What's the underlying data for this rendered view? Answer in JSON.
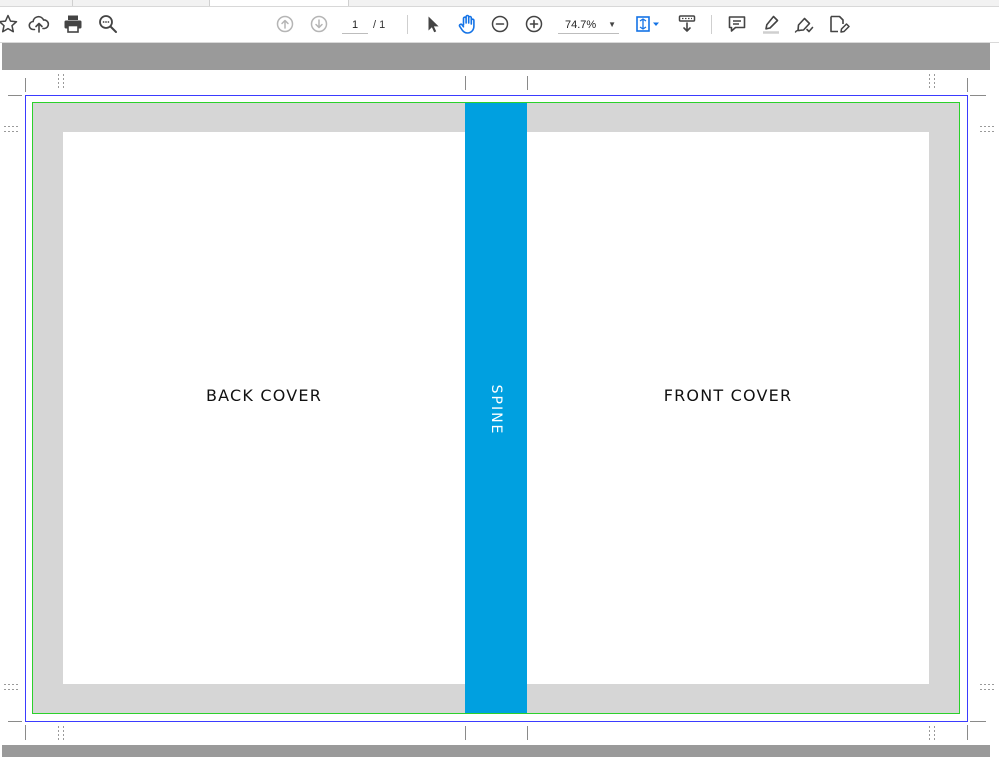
{
  "toolbar": {
    "icons": [
      "star-icon",
      "cloud-upload-icon",
      "print-icon",
      "search-icon",
      "page-up-icon",
      "page-down-icon",
      "select-arrow-icon",
      "hand-icon",
      "zoom-out-icon",
      "zoom-in-icon",
      "fit-page-icon",
      "page-display-icon",
      "comment-icon",
      "highlight-icon",
      "sign-icon",
      "edit-pdf-icon"
    ],
    "page_current": "1",
    "page_total": "/ 1",
    "zoom": "74.7%"
  },
  "document": {
    "back_cover": "BACK COVER",
    "spine": "SPINE",
    "front_cover": "FRONT COVER"
  },
  "colors": {
    "spine": "#00a0e0",
    "bleed": "#d6d6d6",
    "trim_line": "#3b3bff",
    "safe_line": "#2bd12b",
    "viewer_gray": "#9a9a9a",
    "active_tool": "#1473e6"
  }
}
